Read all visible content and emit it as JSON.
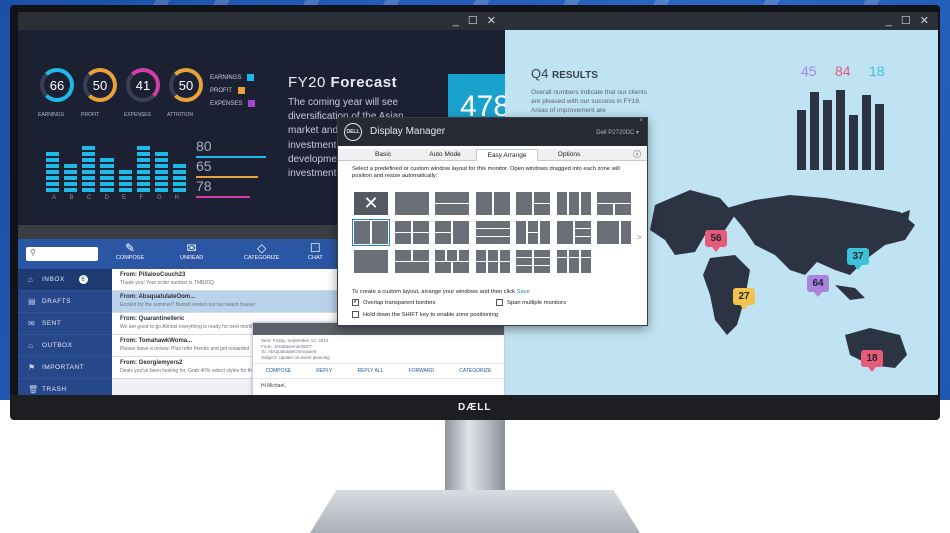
{
  "window_left": {
    "controls": "_ ☐ ✕"
  },
  "window_right": {
    "controls": "_ ☐ ✕"
  },
  "dashboard": {
    "gauges": [
      {
        "value": "66",
        "label": "EARNINGS",
        "color": "#1fb9e8"
      },
      {
        "value": "50",
        "label": "PROFIT",
        "color": "#e8a23a"
      },
      {
        "value": "41",
        "label": "EXPENSES",
        "color": "#d23ea8"
      },
      {
        "value": "50",
        "label": "ATTRITION",
        "color": "#e8a23a"
      }
    ],
    "legend": [
      {
        "label": "EARNINGS",
        "color": "#1fb9e8"
      },
      {
        "label": "PROFIT",
        "color": "#e8a23a"
      },
      {
        "label": "EXPENSES",
        "color": "#a347d6"
      }
    ],
    "bar_letters": [
      "A",
      "B",
      "C",
      "D",
      "E",
      "F",
      "G",
      "H"
    ],
    "bar_levels": [
      7,
      5,
      8,
      6,
      4,
      8,
      7,
      5
    ],
    "big_numbers": [
      {
        "value": "80",
        "color": "#1fb9e8"
      },
      {
        "value": "65",
        "color": "#e8a23a"
      },
      {
        "value": "78",
        "color": "#d23ea8"
      }
    ],
    "forecast_title_light": "FY20",
    "forecast_title_bold": "Forecast",
    "forecast_body": "The coming year will see diversification of the Asian market and growth in the investment s goals will be development market and h investment r",
    "teal_number": "478"
  },
  "mail": {
    "search_placeholder": "",
    "toolbar": [
      {
        "icon": "✎",
        "label": "COMPOSE"
      },
      {
        "icon": "✉",
        "label": "UNREAD"
      },
      {
        "icon": "◇",
        "label": "CATEGORIZE"
      },
      {
        "icon": "☐",
        "label": "CHAT"
      }
    ],
    "folders": [
      {
        "icon": "⌂",
        "label": "INBOX",
        "badge": "6"
      },
      {
        "icon": "▤",
        "label": "DRAFTS"
      },
      {
        "icon": "✉",
        "label": "SENT"
      },
      {
        "icon": "⌂",
        "label": "OUTBOX"
      },
      {
        "icon": "⚑",
        "label": "IMPORTANT"
      },
      {
        "icon": "🗑",
        "label": "TRASH"
      }
    ],
    "messages": [
      {
        "from": "From: PillalooCouch23",
        "subject": "Thank you! Your order number is TMB20Q"
      },
      {
        "from": "From: AbsquatulateOom...",
        "subject": "Excited for the summer? Barrett vented our fav beach house!"
      },
      {
        "from": "From: Quarantinelleric",
        "subject": "We are good to go Almost everything is ready for next month"
      },
      {
        "from": "From: TomahawkWoma...",
        "subject": "Please leave a review. Plus refer friends and get rewarded"
      },
      {
        "from": "From: Georgiemyers2",
        "subject": "Deals you've been looking for. Grab 40% select styles for this"
      }
    ],
    "preview": {
      "meta": [
        "Sent: Friday, September 14, 2012",
        "From: JeraBasementSST",
        "To: AbsquatulateOomouse6",
        "Subject: Update on event planning"
      ],
      "actions": [
        "COMPOSE",
        "REPLY",
        "REPLY ALL",
        "FORWARD",
        "CATEGORIZE"
      ],
      "greeting": "Hi Michael,"
    }
  },
  "q4": {
    "title_light": "Q4",
    "title_bold": "RESULTS",
    "body": "Overall numbers indicate that our clients are pleased with our success in FY18. Areas of improvement are",
    "numbers": [
      {
        "value": "45",
        "color": "#a983e0"
      },
      {
        "value": "84",
        "color": "#e85a7a"
      },
      {
        "value": "18",
        "color": "#3dc3d8"
      }
    ],
    "bars": [
      60,
      78,
      70,
      80,
      55,
      75,
      66
    ],
    "pins": [
      {
        "value": "56",
        "color": "#e85a7a"
      },
      {
        "value": "37",
        "color": "#3dc3d8"
      },
      {
        "value": "64",
        "color": "#a983e0"
      },
      {
        "value": "27",
        "color": "#f0c44c"
      },
      {
        "value": "18",
        "color": "#e85a7a"
      }
    ]
  },
  "dialog": {
    "logo": "DELL",
    "title": "Display Manager",
    "monitor": "Dell P2720DC ▾",
    "close": "×",
    "tabs": [
      "Basic",
      "Auto Mode",
      "Easy Arrange",
      "Options"
    ],
    "active_tab": "Easy Arrange",
    "info_icon": "ⓘ",
    "description": "Select a predefined or custom window layout for this monitor. Open windows dragged into each zone will position and resize automatically:",
    "custom_text": "To create a custom layout, arrange your windows and then click",
    "save_link": "Save",
    "options": [
      {
        "label": "Overlap transparent borders",
        "checked": true
      },
      {
        "label": "Span multiple monitors",
        "checked": false
      },
      {
        "label": "Hold down the SHIFT key to enable zone positioning",
        "checked": false
      }
    ],
    "more": ">"
  },
  "brand": "DÆLL"
}
